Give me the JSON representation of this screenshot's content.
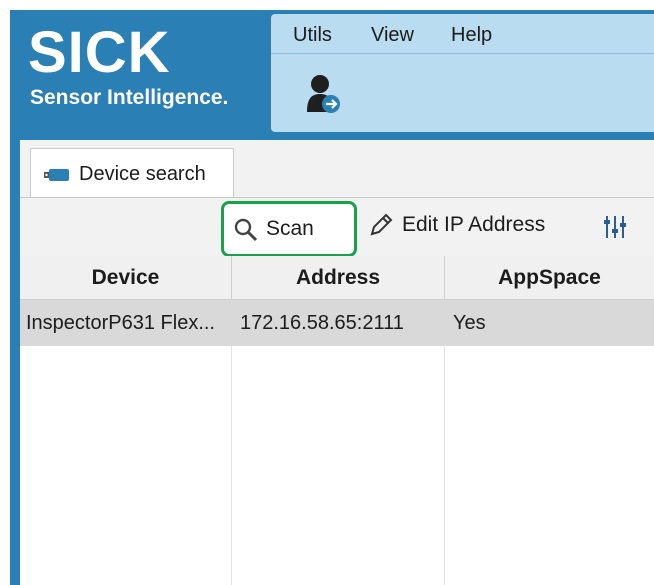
{
  "brand": {
    "name": "SICK",
    "tagline": "Sensor Intelligence."
  },
  "menu": {
    "items": [
      "Utils",
      "View",
      "Help"
    ]
  },
  "tabs": [
    {
      "label": "Device search"
    }
  ],
  "toolbar": {
    "scan_label": "Scan",
    "edit_ip_label": "Edit IP Address"
  },
  "table": {
    "columns": [
      "Device",
      "Address",
      "AppSpace"
    ],
    "rows": [
      [
        "InspectorP631 Flex...",
        "172.16.58.65:2111",
        "Yes"
      ]
    ]
  },
  "colors": {
    "brand_blue": "#2a7fb4",
    "menu_panel": "#b9dcf0",
    "highlight_green": "#16a34a"
  }
}
